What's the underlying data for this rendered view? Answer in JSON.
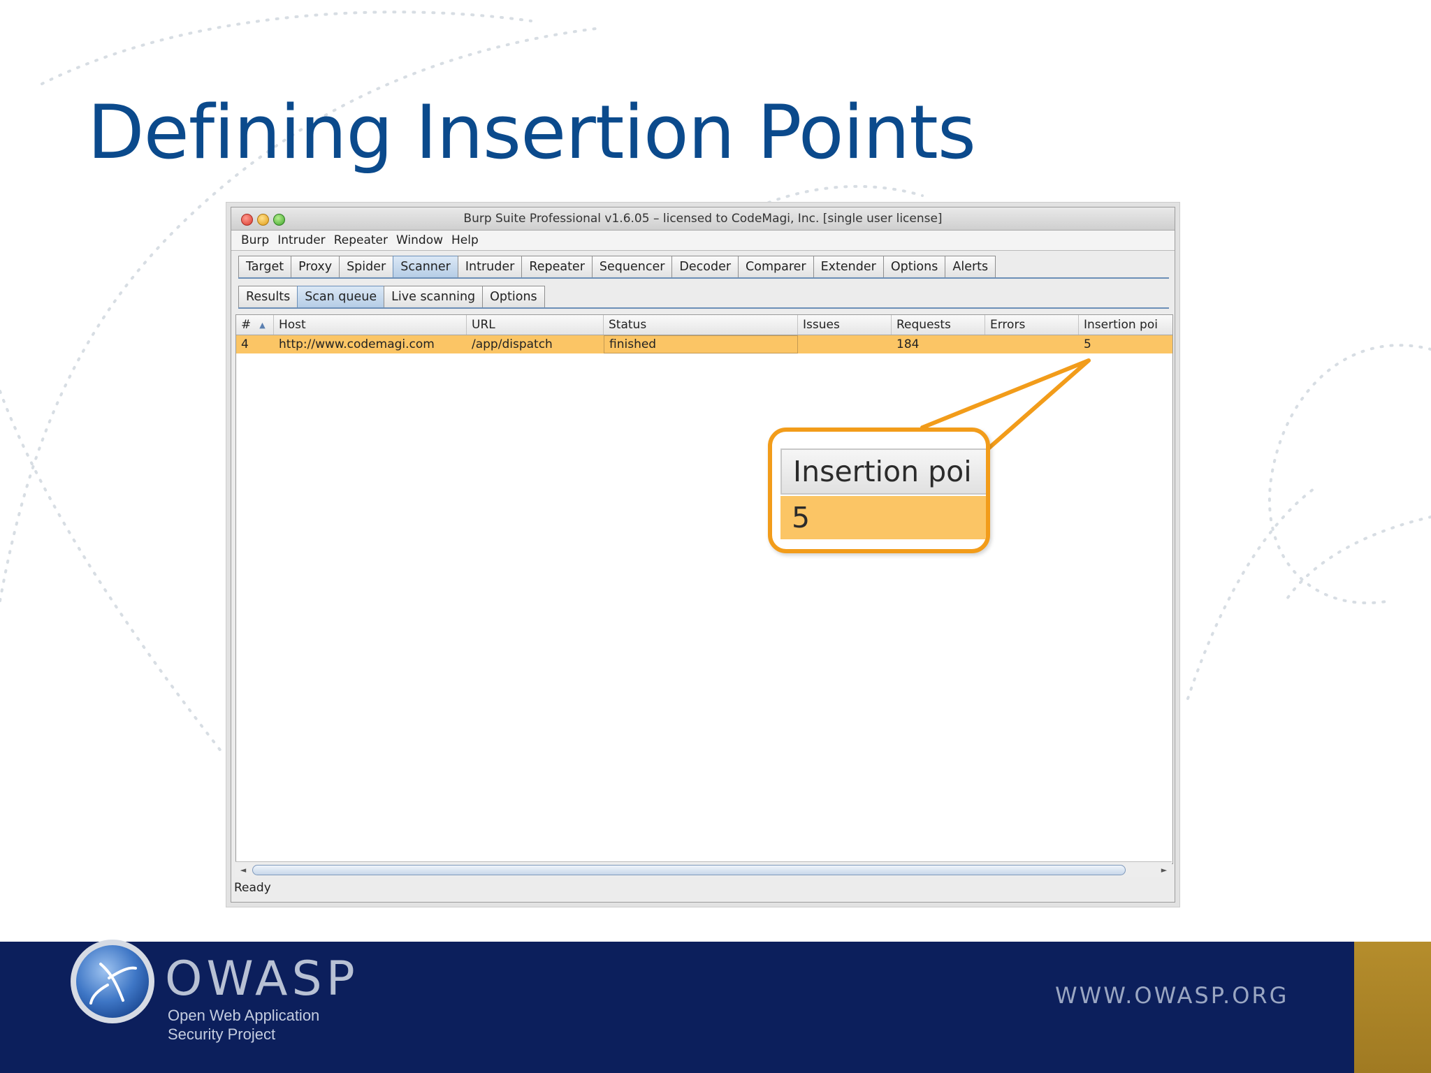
{
  "slide": {
    "title": "Defining Insertion Points"
  },
  "window": {
    "title": "Burp Suite Professional v1.6.05 – licensed to CodeMagi, Inc. [single user license]",
    "menu": [
      "Burp",
      "Intruder",
      "Repeater",
      "Window",
      "Help"
    ],
    "main_tabs": [
      "Target",
      "Proxy",
      "Spider",
      "Scanner",
      "Intruder",
      "Repeater",
      "Sequencer",
      "Decoder",
      "Comparer",
      "Extender",
      "Options",
      "Alerts"
    ],
    "main_tab_active": "Scanner",
    "sub_tabs": [
      "Results",
      "Scan queue",
      "Live scanning",
      "Options"
    ],
    "sub_tab_active": "Scan queue",
    "status": "Ready"
  },
  "table": {
    "columns": [
      "#",
      "Host",
      "URL",
      "Status",
      "Issues",
      "Requests",
      "Errors",
      "Insertion poi"
    ],
    "sort_indicator": "▲",
    "rows": [
      [
        "4",
        "http://www.codemagi.com",
        "/app/dispatch",
        "finished",
        "",
        "184",
        "",
        "5"
      ]
    ]
  },
  "callout": {
    "header": "Insertion poi",
    "value": "5"
  },
  "scrollbar": {
    "left_arrow": "◄",
    "right_arrow": "►"
  },
  "footer": {
    "logo_word": "OWASP",
    "logo_sub_line1": "Open Web Application",
    "logo_sub_line2": "Security Project",
    "url": "WWW.OWASP.ORG"
  },
  "colors": {
    "title_blue": "#0b4a8c",
    "row_highlight": "#fbc565",
    "callout_orange": "#f29c1a",
    "footer_navy": "#0c1f5c",
    "footer_gold": "#b58d2c"
  }
}
